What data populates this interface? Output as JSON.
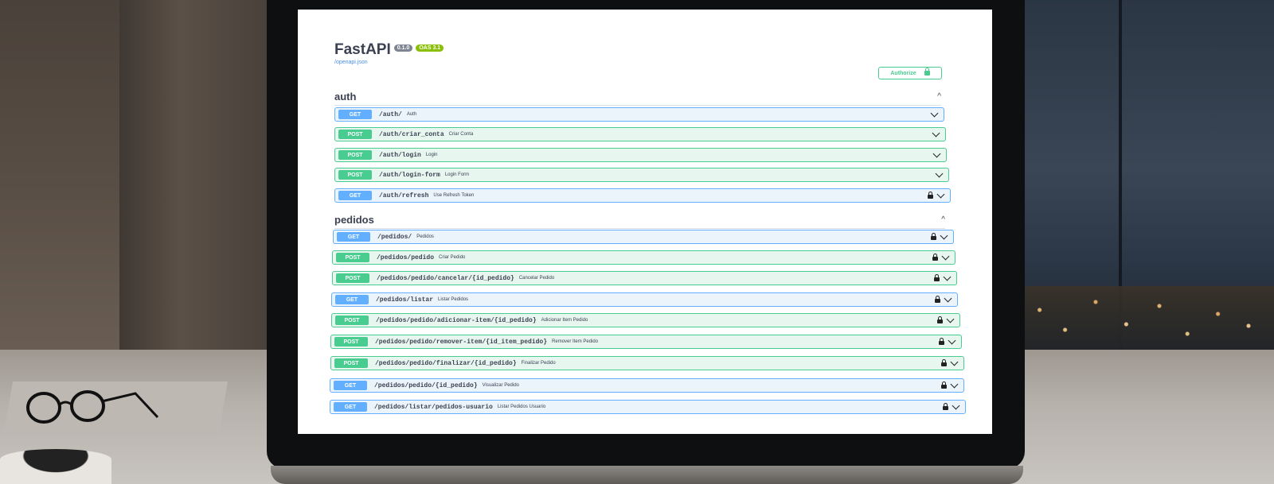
{
  "api": {
    "title": "FastAPI",
    "version": "0.1.0",
    "oas": "OAS 3.1",
    "spec_link": "/openapi.json",
    "authorize_label": "Authorize"
  },
  "tags": [
    {
      "name": "auth",
      "collapse_icon": "^",
      "operations": [
        {
          "method": "GET",
          "path": "/auth/",
          "summary": "Auth",
          "locked": false
        },
        {
          "method": "POST",
          "path": "/auth/criar_conta",
          "summary": "Criar Conta",
          "locked": false
        },
        {
          "method": "POST",
          "path": "/auth/login",
          "summary": "Login",
          "locked": false
        },
        {
          "method": "POST",
          "path": "/auth/login-form",
          "summary": "Login Form",
          "locked": false
        },
        {
          "method": "GET",
          "path": "/auth/refresh",
          "summary": "Use Refresh Token",
          "locked": true
        }
      ]
    },
    {
      "name": "pedidos",
      "collapse_icon": "^",
      "operations": [
        {
          "method": "GET",
          "path": "/pedidos/",
          "summary": "Pedidos",
          "locked": true
        },
        {
          "method": "POST",
          "path": "/pedidos/pedido",
          "summary": "Criar Pedido",
          "locked": true
        },
        {
          "method": "POST",
          "path": "/pedidos/pedido/cancelar/{id_pedido}",
          "summary": "Cancelar Pedido",
          "locked": true
        },
        {
          "method": "GET",
          "path": "/pedidos/listar",
          "summary": "Listar Pedidos",
          "locked": true
        },
        {
          "method": "POST",
          "path": "/pedidos/pedido/adicionar-item/{id_pedido}",
          "summary": "Adicionar Item Pedido",
          "locked": true
        },
        {
          "method": "POST",
          "path": "/pedidos/pedido/remover-item/{id_item_pedido}",
          "summary": "Remover Item Pedido",
          "locked": true
        },
        {
          "method": "POST",
          "path": "/pedidos/pedido/finalizar/{id_pedido}",
          "summary": "Finalizar Pedido",
          "locked": true
        },
        {
          "method": "GET",
          "path": "/pedidos/pedido/{id_pedido}",
          "summary": "Visualizar Pedido",
          "locked": true
        },
        {
          "method": "GET",
          "path": "/pedidos/listar/pedidos-usuario",
          "summary": "Listar Pedidos Usuario",
          "locked": true
        }
      ]
    }
  ],
  "colors": {
    "get": "#61affe",
    "post": "#49cc90",
    "text": "#3b4151"
  }
}
